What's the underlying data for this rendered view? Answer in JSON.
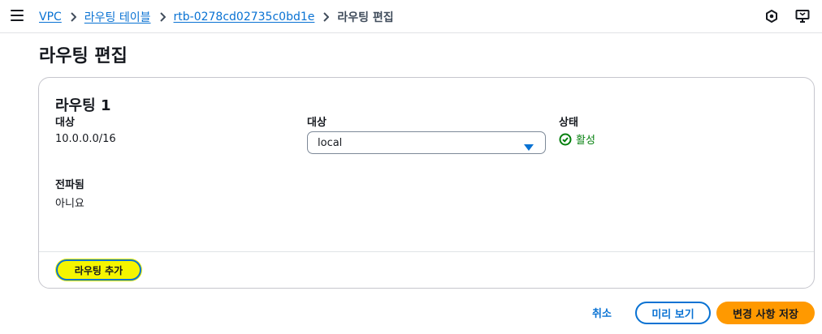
{
  "header": {
    "menu_icon": "hamburger-menu-icon",
    "breadcrumbs": [
      {
        "label": "VPC"
      },
      {
        "label": "라우팅 테이블"
      },
      {
        "label": "rtb-0278cd02735c0bd1e"
      }
    ],
    "current": "라우팅 편집",
    "icons": [
      "settings-hex-icon",
      "feedback-screen-icon"
    ]
  },
  "page": {
    "title": "라우팅 편집"
  },
  "route": {
    "title": "라우팅 1",
    "destination_label": "대상",
    "destination_value": "10.0.0.0/16",
    "target_label": "대상",
    "target_value": "local",
    "status_label": "상태",
    "status_value": "활성",
    "propagated_label": "전파됨",
    "propagated_value": "아니요"
  },
  "actions": {
    "add_route": "라우팅 추가",
    "cancel": "취소",
    "preview": "미리 보기",
    "save": "변경 사항 저장"
  },
  "colors": {
    "link": "#0972d3",
    "primary_button": "#ff9900",
    "success": "#037f0c",
    "highlight": "#f5f500"
  }
}
